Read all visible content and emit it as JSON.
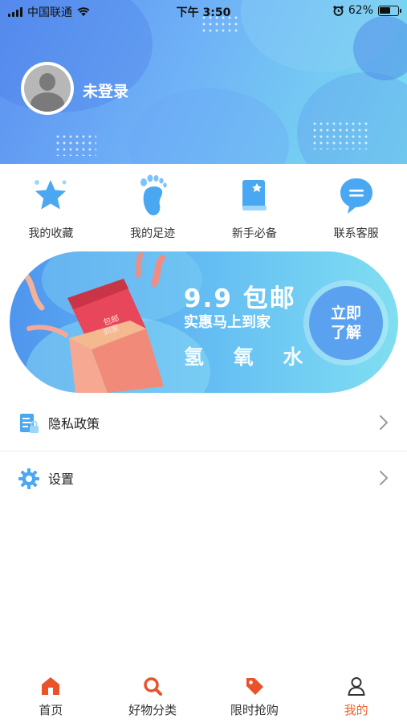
{
  "status_bar": {
    "carrier": "中国联通",
    "time": "下午 3:50",
    "battery": "62%",
    "battery_level": 0.62
  },
  "profile": {
    "login_label": "未登录"
  },
  "quick_links": [
    {
      "label": "我的收藏",
      "icon": "star-icon"
    },
    {
      "label": "我的足迹",
      "icon": "footprint-icon"
    },
    {
      "label": "新手必备",
      "icon": "guide-book-icon"
    },
    {
      "label": "联系客服",
      "icon": "chat-bubble-icon"
    }
  ],
  "banner": {
    "headline": "9.9 包邮",
    "subline": "实惠马上到家",
    "product": "氢 氧 水",
    "cta_line1": "立即",
    "cta_line2": "了解",
    "box_text": "包邮\n到家"
  },
  "menu": [
    {
      "label": "隐私政策",
      "icon": "privacy-document-icon"
    },
    {
      "label": "设置",
      "icon": "gear-icon"
    }
  ],
  "tabbar": {
    "items": [
      {
        "label": "首页",
        "icon": "home-icon"
      },
      {
        "label": "好物分类",
        "icon": "search-icon"
      },
      {
        "label": "限时抢购",
        "icon": "price-tag-icon"
      },
      {
        "label": "我的",
        "icon": "person-icon"
      }
    ],
    "active_index": 3,
    "active_color": "#f0622e",
    "accent_color": "#e8532a"
  },
  "colors": {
    "header_start": "#5b8ff0",
    "header_end": "#79e0ef",
    "icon_blue": "#4aa7f2"
  }
}
